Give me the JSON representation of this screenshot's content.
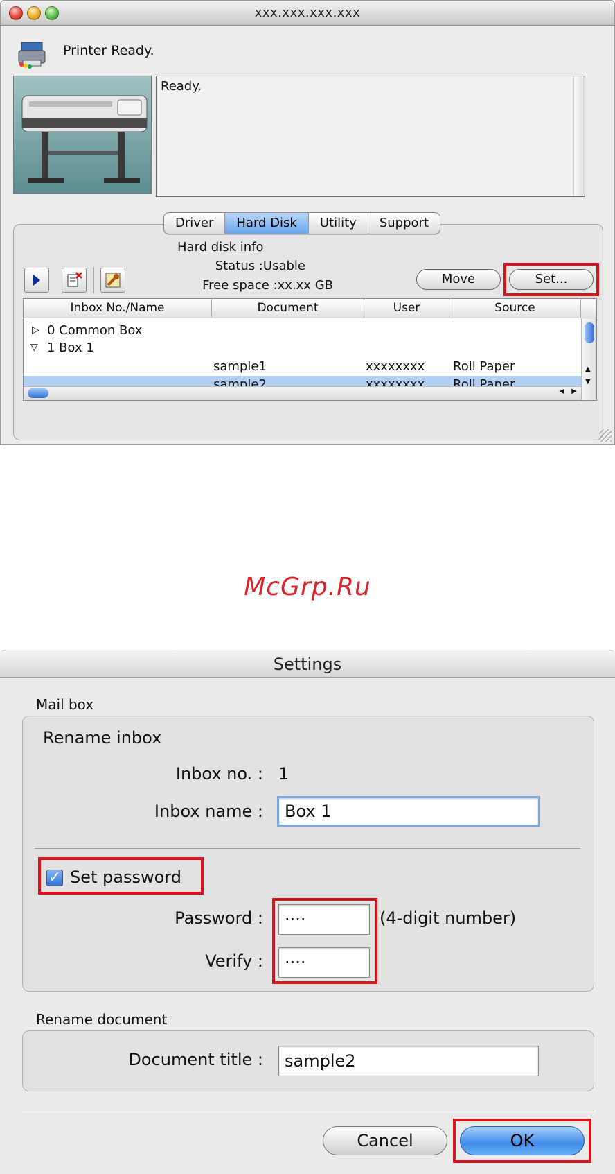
{
  "window_title": "xxx.xxx.xxx.xxx",
  "printer_status": "Printer Ready.",
  "message": "Ready.",
  "tabs": [
    {
      "label": "Driver",
      "active": false
    },
    {
      "label": "Hard Disk",
      "active": true
    },
    {
      "label": "Utility",
      "active": false
    },
    {
      "label": "Support",
      "active": false
    }
  ],
  "hard_disk": {
    "heading": "Hard disk info",
    "status_label": "Status :",
    "status_value": "Usable",
    "free_label": "Free space :",
    "free_value": "xx.xx GB"
  },
  "buttons": {
    "move": "Move",
    "set": "Set..."
  },
  "table": {
    "columns": [
      "Inbox No./Name",
      "Document",
      "User",
      "Source"
    ],
    "rows": [
      {
        "name": "0 Common Box",
        "document": "",
        "user": "",
        "source": "",
        "expander": "▷"
      },
      {
        "name": "1 Box 1",
        "document": "",
        "user": "",
        "source": "",
        "expander": "▽"
      },
      {
        "name": "",
        "document": "sample1",
        "user": "xxxxxxxx",
        "source": "Roll Paper",
        "expander": ""
      },
      {
        "name": "",
        "document": "sample2",
        "user": "xxxxxxxx",
        "source": "Roll Paper",
        "expander": "",
        "selected": true
      }
    ]
  },
  "watermark": "McGrp.Ru",
  "settings": {
    "title": "Settings",
    "mailbox_label": "Mail box",
    "rename_inbox": "Rename inbox",
    "inbox_no_label": "Inbox no. :",
    "inbox_no_value": "1",
    "inbox_name_label": "Inbox name :",
    "inbox_name_value": "Box 1",
    "set_password_label": "Set password",
    "set_password_checked": true,
    "password_label": "Password :",
    "password_value": "····",
    "password_hint": "(4-digit number)",
    "verify_label": "Verify :",
    "verify_value": "····",
    "rename_document_label": "Rename document",
    "document_title_label": "Document title :",
    "document_title_value": "sample2",
    "cancel": "Cancel",
    "ok": "OK"
  },
  "colors": {
    "highlight": "#d9121f",
    "selection": "#b2cff4",
    "accent": "#3f8ae8",
    "watermark": "#d8242c"
  }
}
